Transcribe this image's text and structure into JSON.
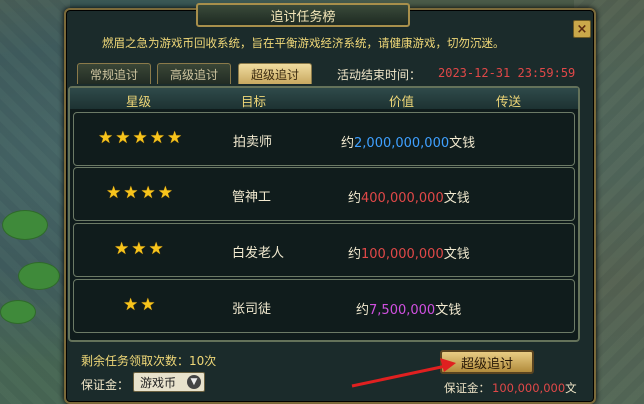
{
  "window": {
    "title": "追讨任务榜",
    "close_label": "×"
  },
  "notice": "燃眉之急为游戏币回收系统，旨在平衡游戏经济系统，请健康游戏，切勿沉迷。",
  "tabs": [
    {
      "label": "常规追讨",
      "active": false
    },
    {
      "label": "高级追讨",
      "active": false
    },
    {
      "label": "超级追讨",
      "active": true
    }
  ],
  "activity": {
    "end_label": "活动结束时间：",
    "end_time": "2023-12-31 23:59:59"
  },
  "table": {
    "headers": [
      "星级",
      "目标",
      "价值",
      "传送"
    ],
    "rows": [
      {
        "stars": 5,
        "target": "拍卖师",
        "prefix": "约",
        "amount": "2,000,000,000",
        "suffix": "文钱",
        "amount_color": "#3fa0ff"
      },
      {
        "stars": 4,
        "target": "管神工",
        "prefix": "约",
        "amount": "400,000,000",
        "suffix": "文钱",
        "amount_color": "#e04848"
      },
      {
        "stars": 3,
        "target": "白发老人",
        "prefix": "约",
        "amount": "100,000,000",
        "suffix": "文钱",
        "amount_color": "#e04848"
      },
      {
        "stars": 2,
        "target": "张司徒",
        "prefix": "约",
        "amount": "7,500,000",
        "suffix": "文钱",
        "amount_color": "#d050e0"
      }
    ]
  },
  "footer": {
    "remaining": "剩余任务领取次数：10次",
    "deposit_label": "保证金：",
    "deposit_currency": "游戏币",
    "action_button": "超级追讨",
    "bond_label": "保证金：",
    "bond_amount": "100,000,000",
    "bond_unit": "文"
  },
  "colors": {
    "accent_gold": "#f0d878",
    "alert_red": "#e04848",
    "star": "#f7c41c"
  }
}
